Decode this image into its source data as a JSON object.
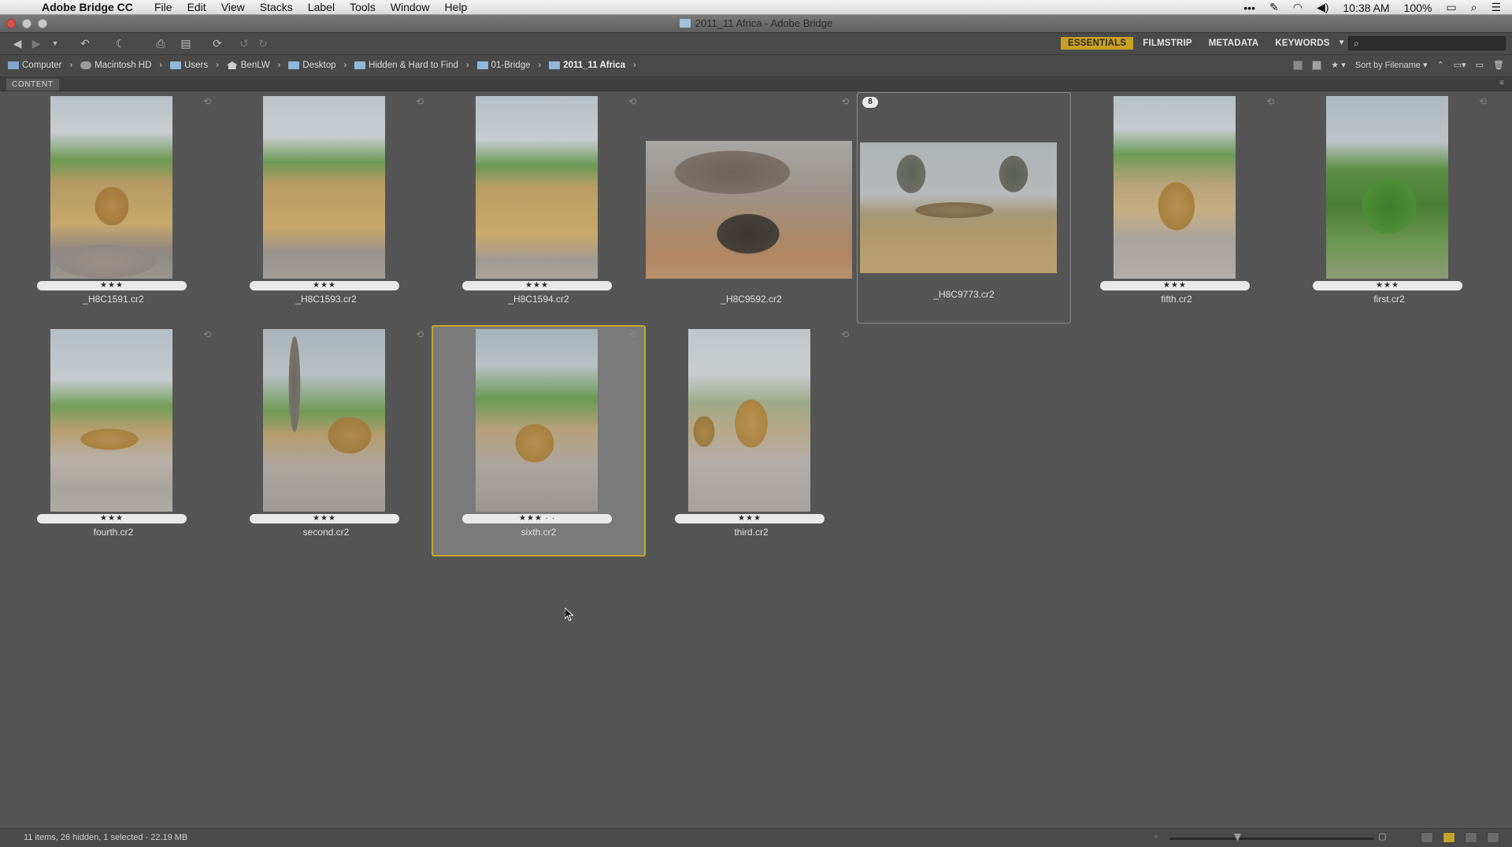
{
  "menubar": {
    "app_name": "Adobe Bridge CC",
    "items": [
      "File",
      "Edit",
      "View",
      "Stacks",
      "Label",
      "Tools",
      "Window",
      "Help"
    ],
    "time": "10:38 AM",
    "battery": "100%"
  },
  "window": {
    "title": "2011_11 Africa - Adobe Bridge"
  },
  "toolbar": {
    "workspaces": [
      {
        "label": "ESSENTIALS",
        "active": true
      },
      {
        "label": "FILMSTRIP",
        "active": false
      },
      {
        "label": "METADATA",
        "active": false
      },
      {
        "label": "KEYWORDS",
        "active": false
      }
    ],
    "search_placeholder": ""
  },
  "pathbar": {
    "crumbs": [
      "Computer",
      "Macintosh HD",
      "Users",
      "BenLW",
      "Desktop",
      "Hidden & Hard to Find",
      "01-Bridge",
      "2011_11 Africa"
    ],
    "sort_label": "Sort by Filename"
  },
  "content": {
    "panel_label": "CONTENT",
    "thumbnails": [
      {
        "name": "_H8C1591.cr2",
        "stars": "★★★",
        "orientation": "portrait"
      },
      {
        "name": "_H8C1593.cr2",
        "stars": "★★★",
        "orientation": "portrait"
      },
      {
        "name": "_H8C1594.cr2",
        "stars": "★★★",
        "orientation": "portrait"
      },
      {
        "name": "_H8C9592.cr2",
        "stars": "",
        "orientation": "landscape"
      },
      {
        "name": "_H8C9773.cr2",
        "stars": "",
        "orientation": "landscape",
        "stack_count": "8"
      },
      {
        "name": "fifth.cr2",
        "stars": "★★★",
        "orientation": "portrait"
      },
      {
        "name": "first.cr2",
        "stars": "★★★",
        "orientation": "portrait"
      },
      {
        "name": "fourth.cr2",
        "stars": "★★★",
        "orientation": "portrait"
      },
      {
        "name": "second.cr2",
        "stars": "★★★",
        "orientation": "portrait"
      },
      {
        "name": "sixth.cr2",
        "stars": "★★★ · ·",
        "orientation": "portrait",
        "selected": true
      },
      {
        "name": "third.cr2",
        "stars": "★★★",
        "orientation": "portrait"
      }
    ]
  },
  "status": {
    "text": "11 items, 26 hidden, 1 selected - 22.19 MB"
  }
}
